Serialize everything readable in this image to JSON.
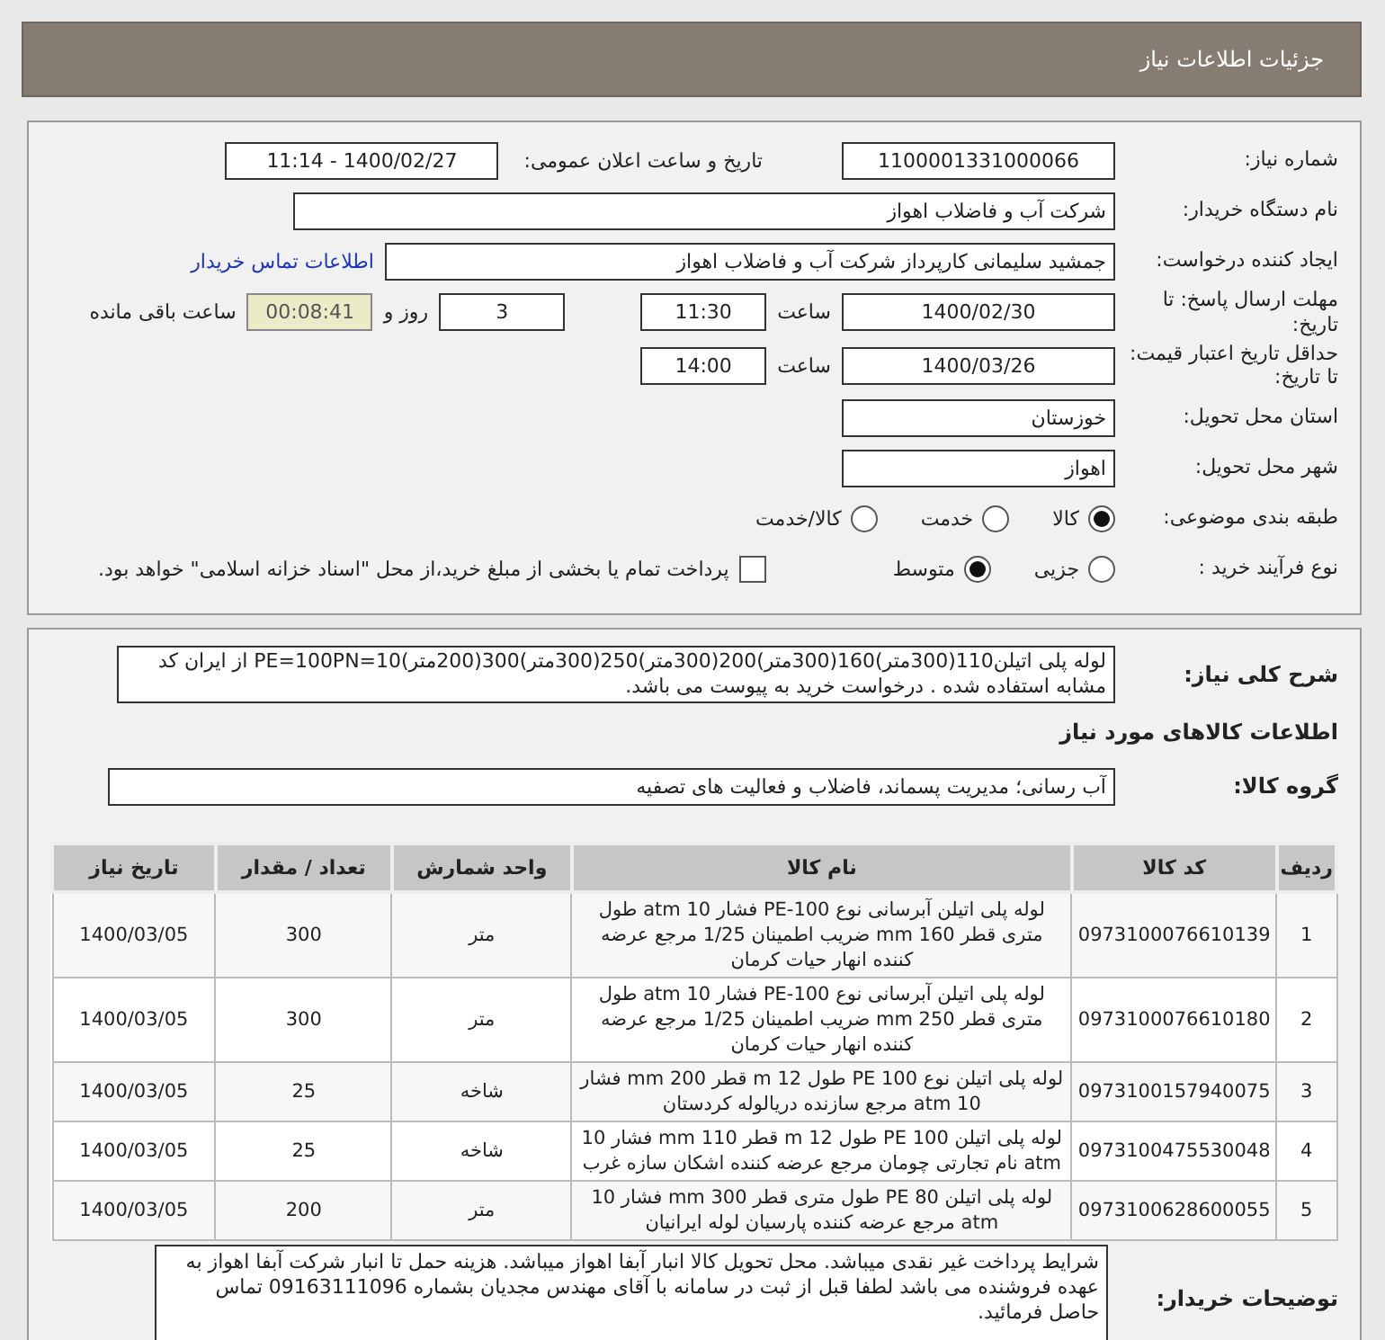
{
  "header": {
    "title": "جزئیات اطلاعات نیاز"
  },
  "need_number": {
    "label": "شماره نیاز:",
    "value": "1100001331000066"
  },
  "announce": {
    "label": "تاریخ و ساعت اعلان عمومی:",
    "value": "1400/02/27 - 11:14"
  },
  "buyer_org": {
    "label": "نام دستگاه خریدار:",
    "value": "شرکت آب و فاضلاب اهواز"
  },
  "requester": {
    "label": "ایجاد کننده درخواست:",
    "value": "جمشید سلیمانی کارپرداز شرکت آب و فاضلاب اهواز",
    "link": "اطلاعات تماس خریدار"
  },
  "response_deadline": {
    "label": "مهلت ارسال پاسخ: تا تاریخ:",
    "date": "1400/02/30",
    "time_label": "ساعت",
    "time": "11:30",
    "days": "3",
    "days_label": "روز و",
    "remaining": "00:08:41",
    "remaining_label": "ساعت باقی مانده"
  },
  "price_validity": {
    "label": "حداقل تاریخ اعتبار قیمت: تا تاریخ:",
    "date": "1400/03/26",
    "time_label": "ساعت",
    "time": "14:00"
  },
  "province": {
    "label": "استان محل تحویل:",
    "value": "خوزستان"
  },
  "city": {
    "label": "شهر محل تحویل:",
    "value": "اهواز"
  },
  "category": {
    "label": "طبقه بندی موضوعی:",
    "options": [
      {
        "label": "کالا",
        "selected": true
      },
      {
        "label": "خدمت",
        "selected": false
      },
      {
        "label": "کالا/خدمت",
        "selected": false
      }
    ]
  },
  "process": {
    "label": "نوع فرآیند خرید :",
    "options": [
      {
        "label": "جزیی",
        "selected": false
      },
      {
        "label": "متوسط",
        "selected": true
      }
    ],
    "treasury": {
      "checked": false,
      "text": "پرداخت تمام یا بخشی از مبلغ خرید،از محل \"اسناد خزانه اسلامی\" خواهد بود."
    }
  },
  "description": {
    "label": "شرح کلی نیاز:",
    "value": "لوله پلی اتیلن110(300متر)160(300متر)200(300متر)250(300متر)300(200متر)PE=100PN=10 از ایران کد مشابه استفاده شده . درخواست خرید به پیوست می باشد."
  },
  "goods_title": "اطلاعات کالاهای مورد نیاز",
  "goods_group": {
    "label": "گروه کالا:",
    "value": "آب رسانی؛ مدیریت پسماند، فاضلاب و فعالیت های تصفیه"
  },
  "table": {
    "columns": [
      "ردیف",
      "کد کالا",
      "نام کالا",
      "واحد شمارش",
      "تعداد / مقدار",
      "تاریخ نیاز"
    ],
    "rows": [
      [
        "1",
        "0973100076610139",
        "لوله پلی اتیلن آبرسانی نوع PE-100 فشار 10 atm طول متری قطر 160 mm ضریب اطمینان 1/25 مرجع عرضه کننده انهار حیات کرمان",
        "متر",
        "300",
        "1400/03/05"
      ],
      [
        "2",
        "0973100076610180",
        "لوله پلی اتیلن آبرسانی نوع PE-100 فشار 10 atm طول متری قطر 250 mm ضریب اطمینان 1/25 مرجع عرضه کننده انهار حیات کرمان",
        "متر",
        "300",
        "1400/03/05"
      ],
      [
        "3",
        "0973100157940075",
        "لوله پلی اتیلن نوع PE 100 طول 12 m قطر 200 mm فشار 10 atm مرجع سازنده دریالوله کردستان",
        "شاخه",
        "25",
        "1400/03/05"
      ],
      [
        "4",
        "0973100475530048",
        "لوله پلی اتیلن PE 100 طول 12 m قطر 110 mm فشار 10 atm نام تجارتی چومان مرجع عرضه کننده اشکان سازه غرب",
        "شاخه",
        "25",
        "1400/03/05"
      ],
      [
        "5",
        "0973100628600055",
        "لوله پلی اتیلن PE 80 طول متری قطر 300 mm فشار 10 atm مرجع عرضه کننده پارسیان لوله ایرانیان",
        "متر",
        "200",
        "1400/03/05"
      ]
    ]
  },
  "buyer_notes": {
    "label": "توضیحات خریدار:",
    "value": "شرایط پرداخت غیر نقدی میباشد. محل تحویل کالا انبار آبفا اهواز میباشد. هزینه حمل تا  انبار شرکت آبفا اهواز به عهده فروشنده می باشد لطفا قبل از ثبت در سامانه با آقای مهندس مجدیان بشماره 09163111096 تماس حاصل فرمائید."
  }
}
